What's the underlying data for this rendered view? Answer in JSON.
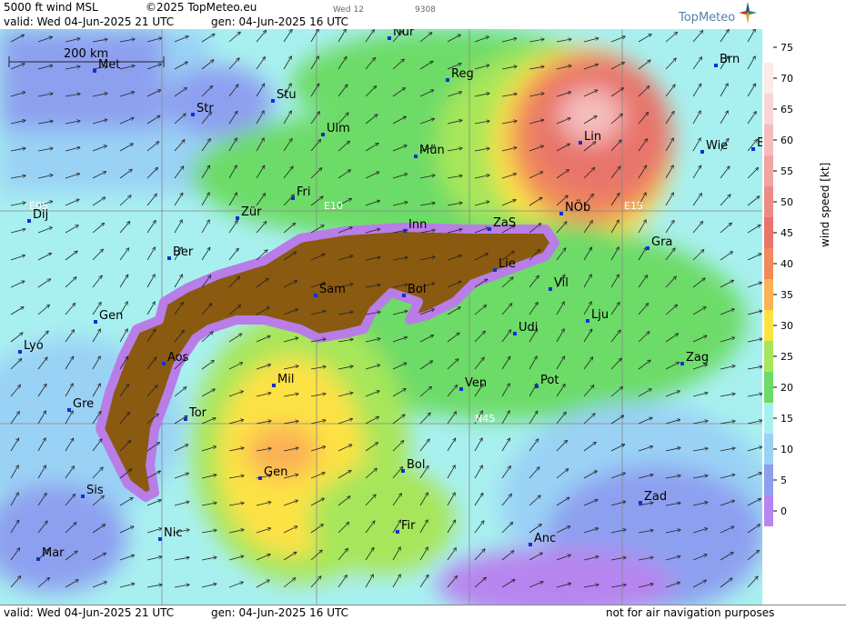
{
  "header": {
    "product": "5000 ft wind MSL",
    "copyright": "©2025 TopMeteo.eu",
    "valid": "valid:  Wed  04-Jun-2025  21 UTC",
    "gen": "gen: 04-Jun-2025 16 UTC",
    "tiny1": "Wed 12",
    "tiny2": "9308",
    "logo": "TopMeteo"
  },
  "footer": {
    "valid": "valid:  Wed  04-Jun-2025  21 UTC",
    "gen": "gen: 04-Jun-2025 16 UTC",
    "disclaimer": "not for air navigation purposes"
  },
  "map": {
    "scale_label": "200 km",
    "grid_labels": [
      "E05",
      "E10",
      "E15",
      "N45"
    ],
    "cities": [
      "Nür",
      "Reg",
      "Brn",
      "Met",
      "Stu",
      "Str",
      "Ulm",
      "Mün",
      "Lin",
      "Wie",
      "B",
      "Fri",
      "Dij",
      "Zür",
      "Inn",
      "ZaS",
      "NÖb",
      "Ber",
      "Lie",
      "Gra",
      "Sam",
      "Bol",
      "Vil",
      "Gen",
      "Lju",
      "Lyo",
      "Udi",
      "Aos",
      "Mil",
      "Ven",
      "Pot",
      "Zag",
      "Gre",
      "Tor",
      "Gen",
      "Bol",
      "Sis",
      "Zad",
      "Nic",
      "Fir",
      "Anc",
      "Mar"
    ]
  },
  "legend": {
    "title": "wind speed  [kt]",
    "ticks": [
      "75",
      "70",
      "65",
      "60",
      "55",
      "50",
      "45",
      "40",
      "35",
      "30",
      "25",
      "20",
      "15",
      "10",
      "5",
      "0"
    ],
    "colors": [
      "#ffffff",
      "#fbeaea",
      "#f8d4d4",
      "#f4bcbc",
      "#f1a5a2",
      "#ec8c86",
      "#e8756c",
      "#f08a5a",
      "#fbb254",
      "#fde245",
      "#a7e65a",
      "#6ddb67",
      "#a8f0f0",
      "#9ad2f5",
      "#8da0f0",
      "#b785ef"
    ]
  },
  "colors": {
    "terrain": "#8a5a10",
    "terrain_edge": "#b97de8",
    "arrow": "#222222"
  }
}
